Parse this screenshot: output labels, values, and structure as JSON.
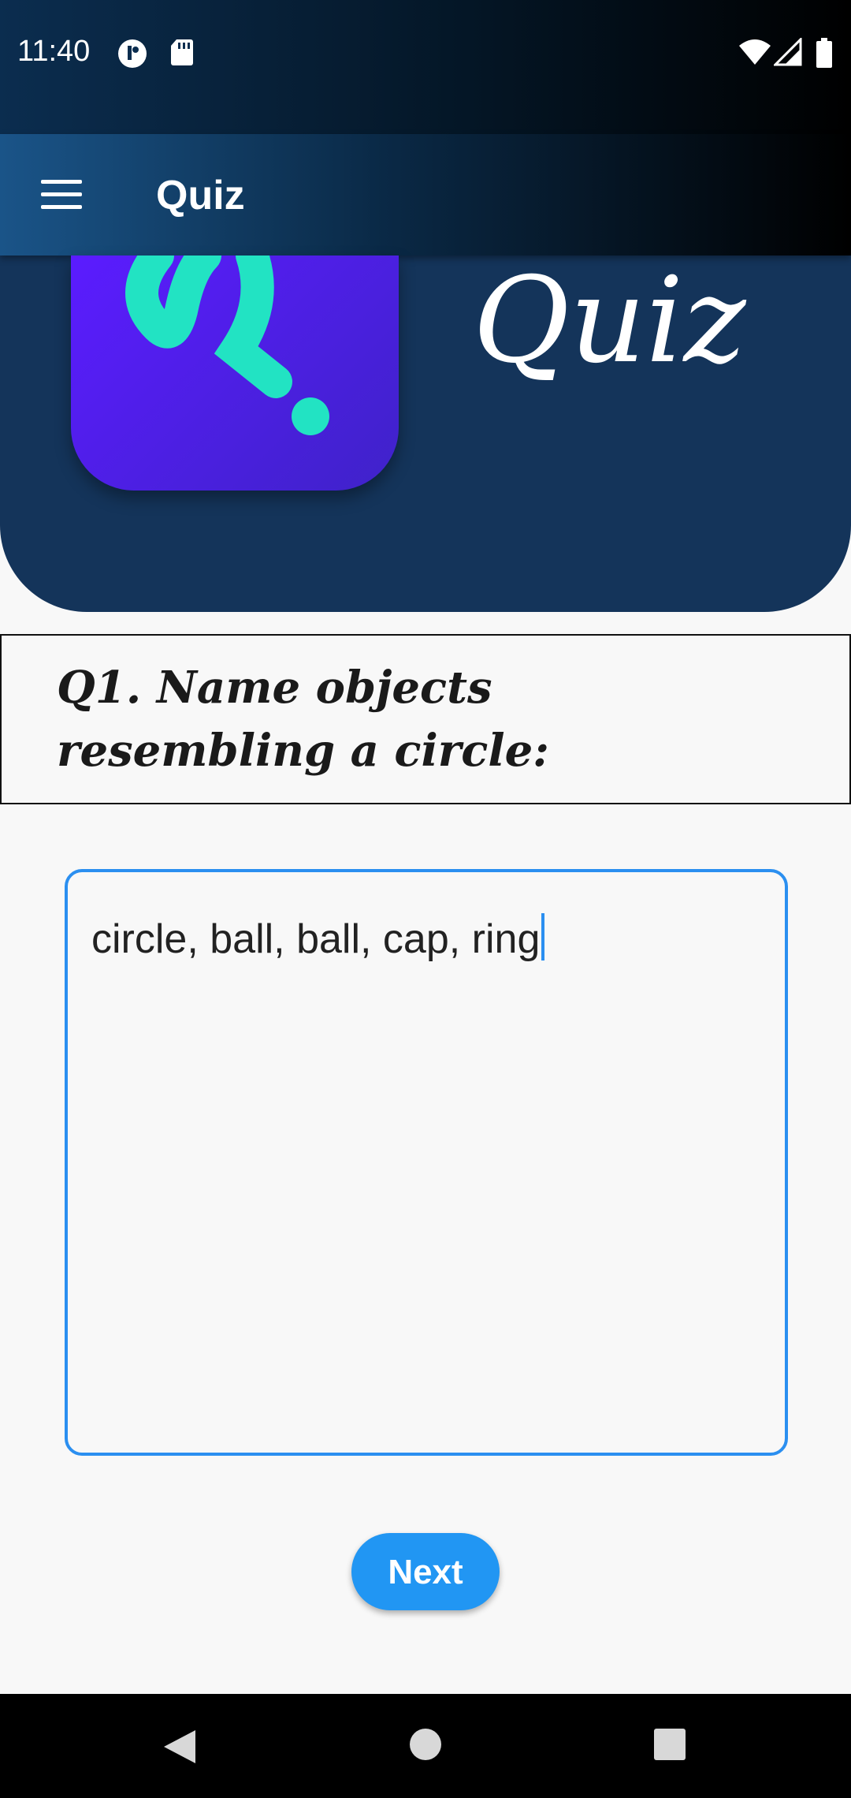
{
  "status_bar": {
    "time": "11:40",
    "left_icons": [
      "notification-app-icon",
      "sd-card-icon"
    ],
    "right_icons": [
      "wifi-icon",
      "signal-icon",
      "battery-icon"
    ]
  },
  "app_bar": {
    "title": "Quiz",
    "menu_icon": "hamburger-menu-icon"
  },
  "banner": {
    "logo_icon": "quiz-logo-icon",
    "word": "Quiz"
  },
  "question": {
    "text": "Q1. Name objects resembling a circle:"
  },
  "answer": {
    "value": "circle, ball, ball, cap, ring"
  },
  "next_button": {
    "label": "Next"
  },
  "nav_bar": {
    "icons": [
      "back-icon",
      "home-icon",
      "recents-icon"
    ]
  },
  "colors": {
    "header": "#14345a",
    "accent": "#2196f3",
    "logo": "#5b1cff",
    "logo_mark": "#22e3c3"
  }
}
